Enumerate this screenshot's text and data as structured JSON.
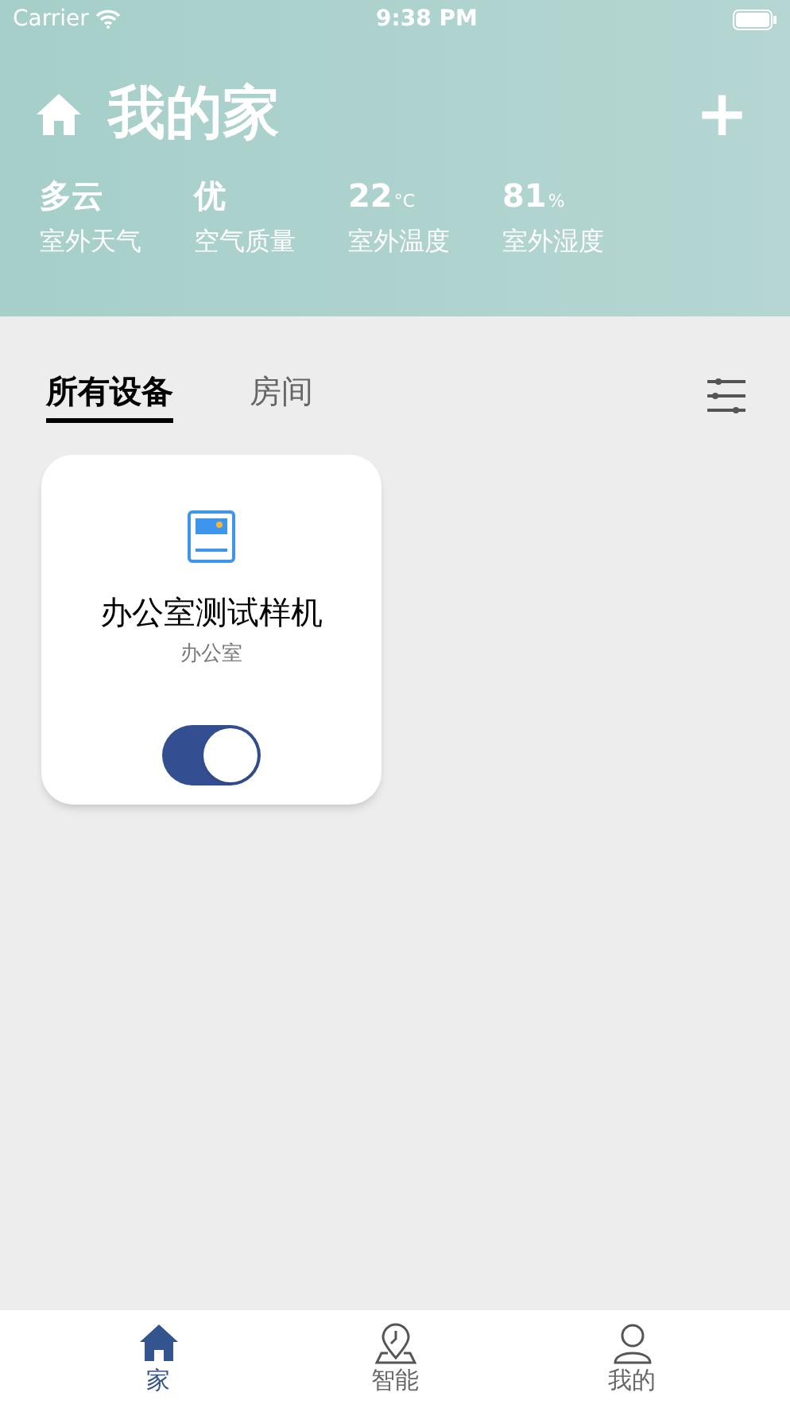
{
  "status_bar": {
    "carrier": "Carrier",
    "time": "9:38 PM"
  },
  "header": {
    "title": "我的家",
    "add": "+"
  },
  "stats": [
    {
      "value": "多云",
      "label": "室外天气"
    },
    {
      "value": "优",
      "label": "空气质量"
    },
    {
      "value": "22",
      "unit": "°C",
      "label": "室外温度"
    },
    {
      "value": "81",
      "unit": "%",
      "label": "室外湿度"
    }
  ],
  "tabs": [
    {
      "label": "所有设备",
      "selected": true
    },
    {
      "label": "房间",
      "selected": false
    }
  ],
  "devices": [
    {
      "name": "办公室测试样机",
      "room": "办公室",
      "on": true
    }
  ],
  "bottom_nav": [
    {
      "label": "家",
      "selected": true
    },
    {
      "label": "智能",
      "selected": false
    },
    {
      "label": "我的",
      "selected": false
    }
  ]
}
